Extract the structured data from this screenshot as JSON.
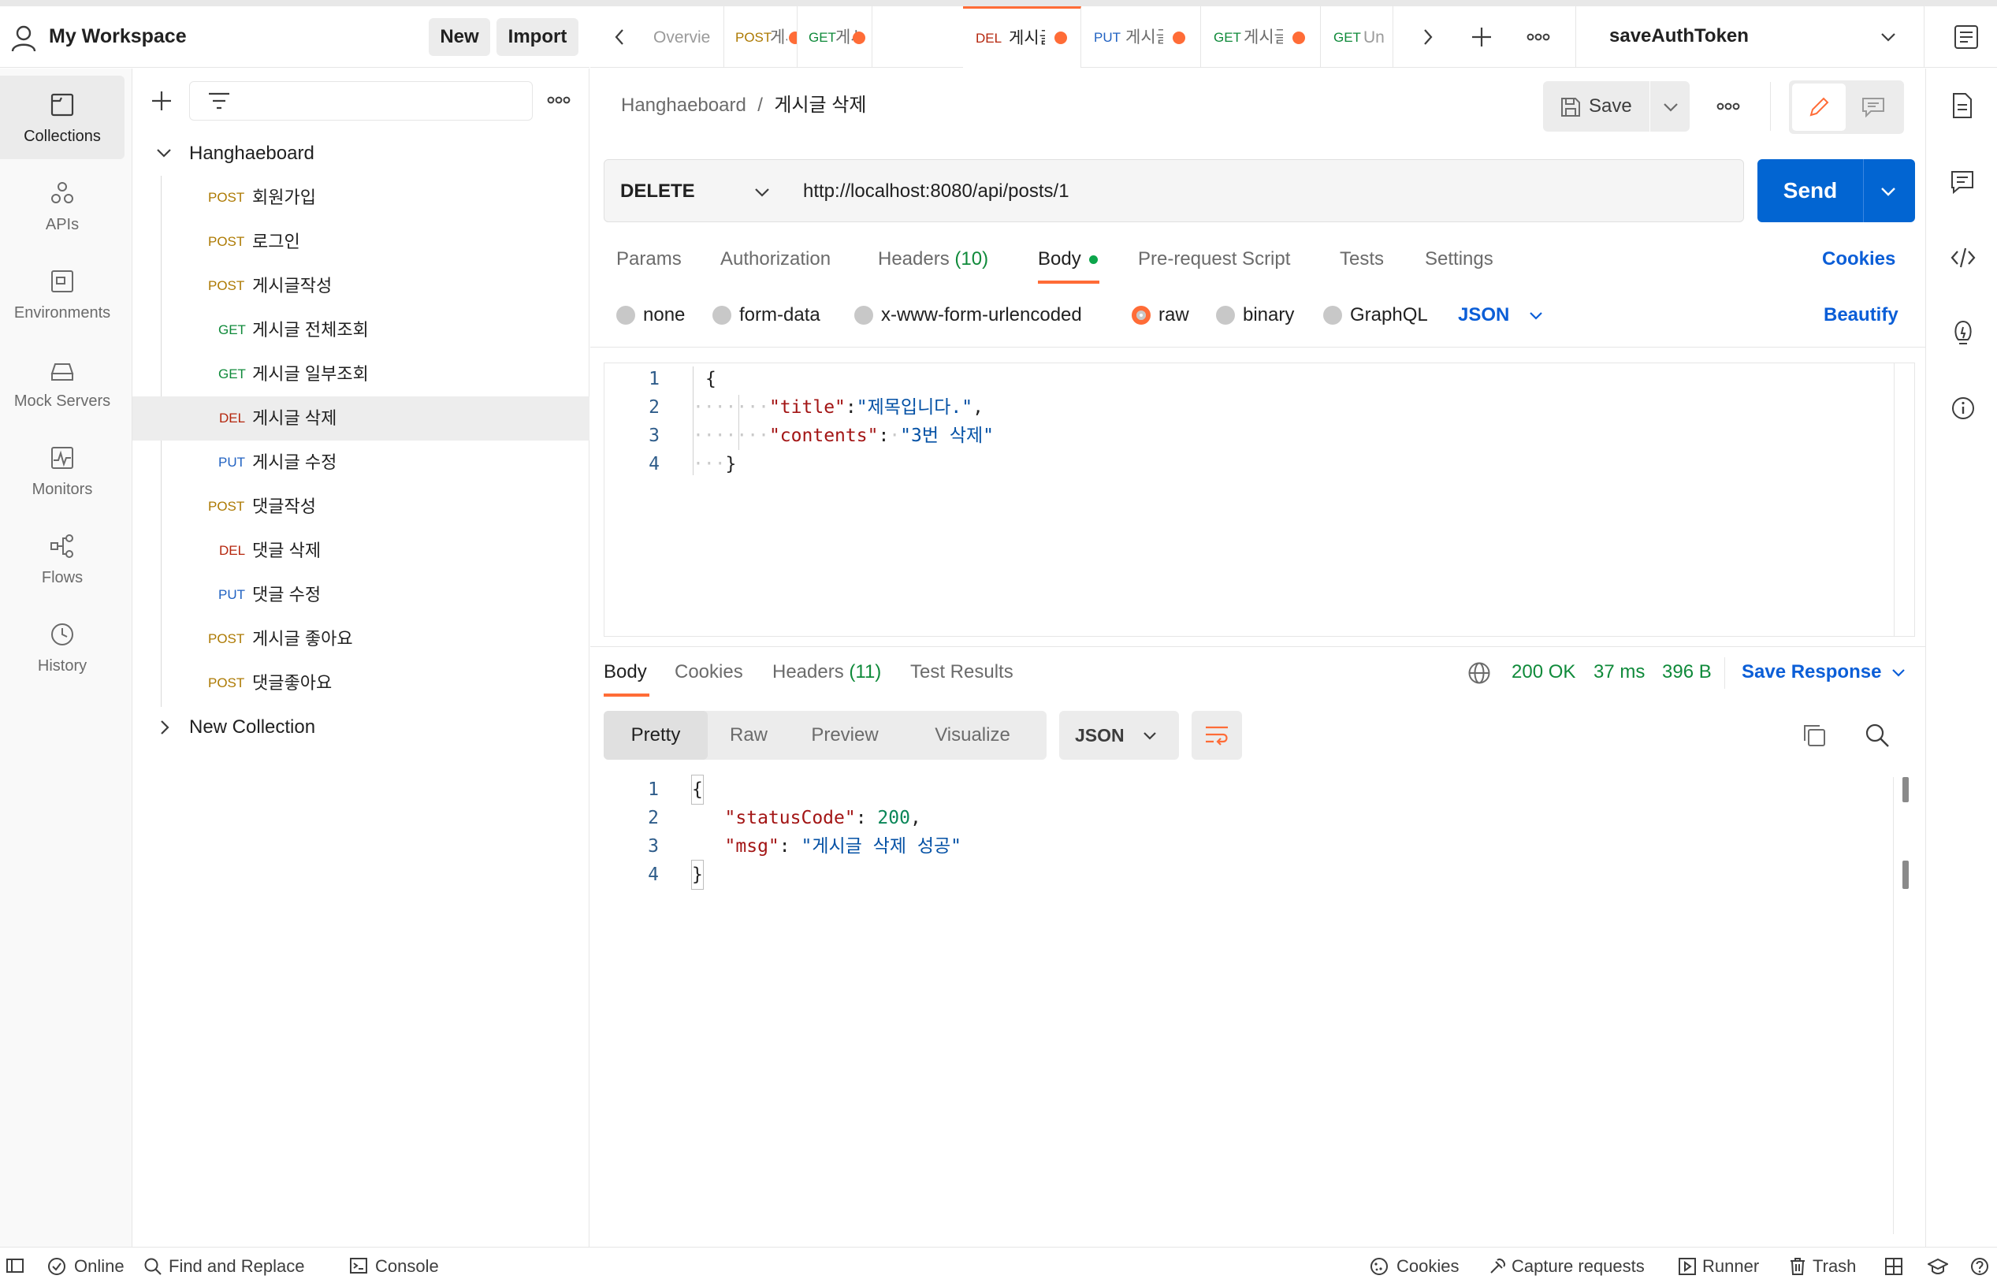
{
  "workspace": {
    "title": "My Workspace",
    "new_label": "New",
    "import_label": "Import"
  },
  "rail": {
    "items": [
      {
        "label": "Collections",
        "icon": "collections-icon"
      },
      {
        "label": "APIs",
        "icon": "apis-icon"
      },
      {
        "label": "Environments",
        "icon": "environments-icon"
      },
      {
        "label": "Mock Servers",
        "icon": "mock-servers-icon"
      },
      {
        "label": "Monitors",
        "icon": "monitors-icon"
      },
      {
        "label": "Flows",
        "icon": "flows-icon"
      },
      {
        "label": "History",
        "icon": "history-icon"
      }
    ]
  },
  "sidebar": {
    "search_placeholder": "",
    "collection": {
      "name": "Hanghaeboard",
      "requests": [
        {
          "method": "POST",
          "name": "회원가입"
        },
        {
          "method": "POST",
          "name": "로그인"
        },
        {
          "method": "POST",
          "name": "게시글작성"
        },
        {
          "method": "GET",
          "name": "게시글 전체조회"
        },
        {
          "method": "GET",
          "name": "게시글 일부조회"
        },
        {
          "method": "DEL",
          "name": "게시글 삭제"
        },
        {
          "method": "PUT",
          "name": "게시글 수정"
        },
        {
          "method": "POST",
          "name": "댓글작성"
        },
        {
          "method": "DEL",
          "name": "댓글 삭제"
        },
        {
          "method": "PUT",
          "name": "댓글 수정"
        },
        {
          "method": "POST",
          "name": "게시글 좋아요"
        },
        {
          "method": "POST",
          "name": "댓글좋아요"
        }
      ]
    },
    "other_collection": "New Collection"
  },
  "tabs": [
    {
      "method": "",
      "label": "Overvie"
    },
    {
      "method": "POST",
      "label": "게시"
    },
    {
      "method": "GET",
      "label": "게시글"
    },
    {
      "method": "DEL",
      "label": "게시글"
    },
    {
      "method": "PUT",
      "label": "게시글"
    },
    {
      "method": "GET",
      "label": "게시글"
    },
    {
      "method": "GET",
      "label": "Un"
    }
  ],
  "environment": {
    "selected": "saveAuthToken"
  },
  "request": {
    "breadcrumb_collection": "Hanghaeboard",
    "breadcrumb_sep": "/",
    "breadcrumb_request": "게시글 삭제",
    "save_label": "Save",
    "method": "DELETE",
    "url": "http://localhost:8080/api/posts/1",
    "send_label": "Send",
    "tabs": {
      "params": "Params",
      "authorization": "Authorization",
      "headers": "Headers",
      "headers_count": "(10)",
      "body": "Body",
      "prerequest": "Pre-request Script",
      "tests": "Tests",
      "settings": "Settings"
    },
    "cookies_label": "Cookies",
    "body_types": {
      "none": "none",
      "form_data": "form-data",
      "urlencoded": "x-www-form-urlencoded",
      "raw": "raw",
      "binary": "binary",
      "graphql": "GraphQL"
    },
    "body_lang": "JSON",
    "beautify_label": "Beautify",
    "body_lines": [
      "1",
      "2",
      "3",
      "4"
    ],
    "body_code": {
      "open": "{",
      "k1": "\"title\"",
      "v1": "\"제목입니다.\"",
      "k2": "\"contents\"",
      "v2": "\"3번 삭제\"",
      "close": "}"
    }
  },
  "response": {
    "tabs": {
      "body": "Body",
      "cookies": "Cookies",
      "headers": "Headers",
      "headers_count": "(11)",
      "test_results": "Test Results"
    },
    "status": "200 OK",
    "time": "37 ms",
    "size": "396 B",
    "save_response_label": "Save Response",
    "views": {
      "pretty": "Pretty",
      "raw": "Raw",
      "preview": "Preview",
      "visualize": "Visualize"
    },
    "lang": "JSON",
    "lines": [
      "1",
      "2",
      "3",
      "4"
    ],
    "code": {
      "open": "{",
      "k1": "\"statusCode\"",
      "v1": "200",
      "k2": "\"msg\"",
      "v2": "\"게시글 삭제 성공\"",
      "close": "}"
    }
  },
  "statusbar": {
    "online": "Online",
    "find_replace": "Find and Replace",
    "console": "Console",
    "cookies": "Cookies",
    "capture": "Capture requests",
    "runner": "Runner",
    "trash": "Trash"
  },
  "colors": {
    "accent": "#ff6c37",
    "send": "#0265d2",
    "post": "#ad7a03",
    "get": "#0f8a3a",
    "del": "#b5260d",
    "put": "#2162c2",
    "status_ok": "#0f8a3a"
  }
}
